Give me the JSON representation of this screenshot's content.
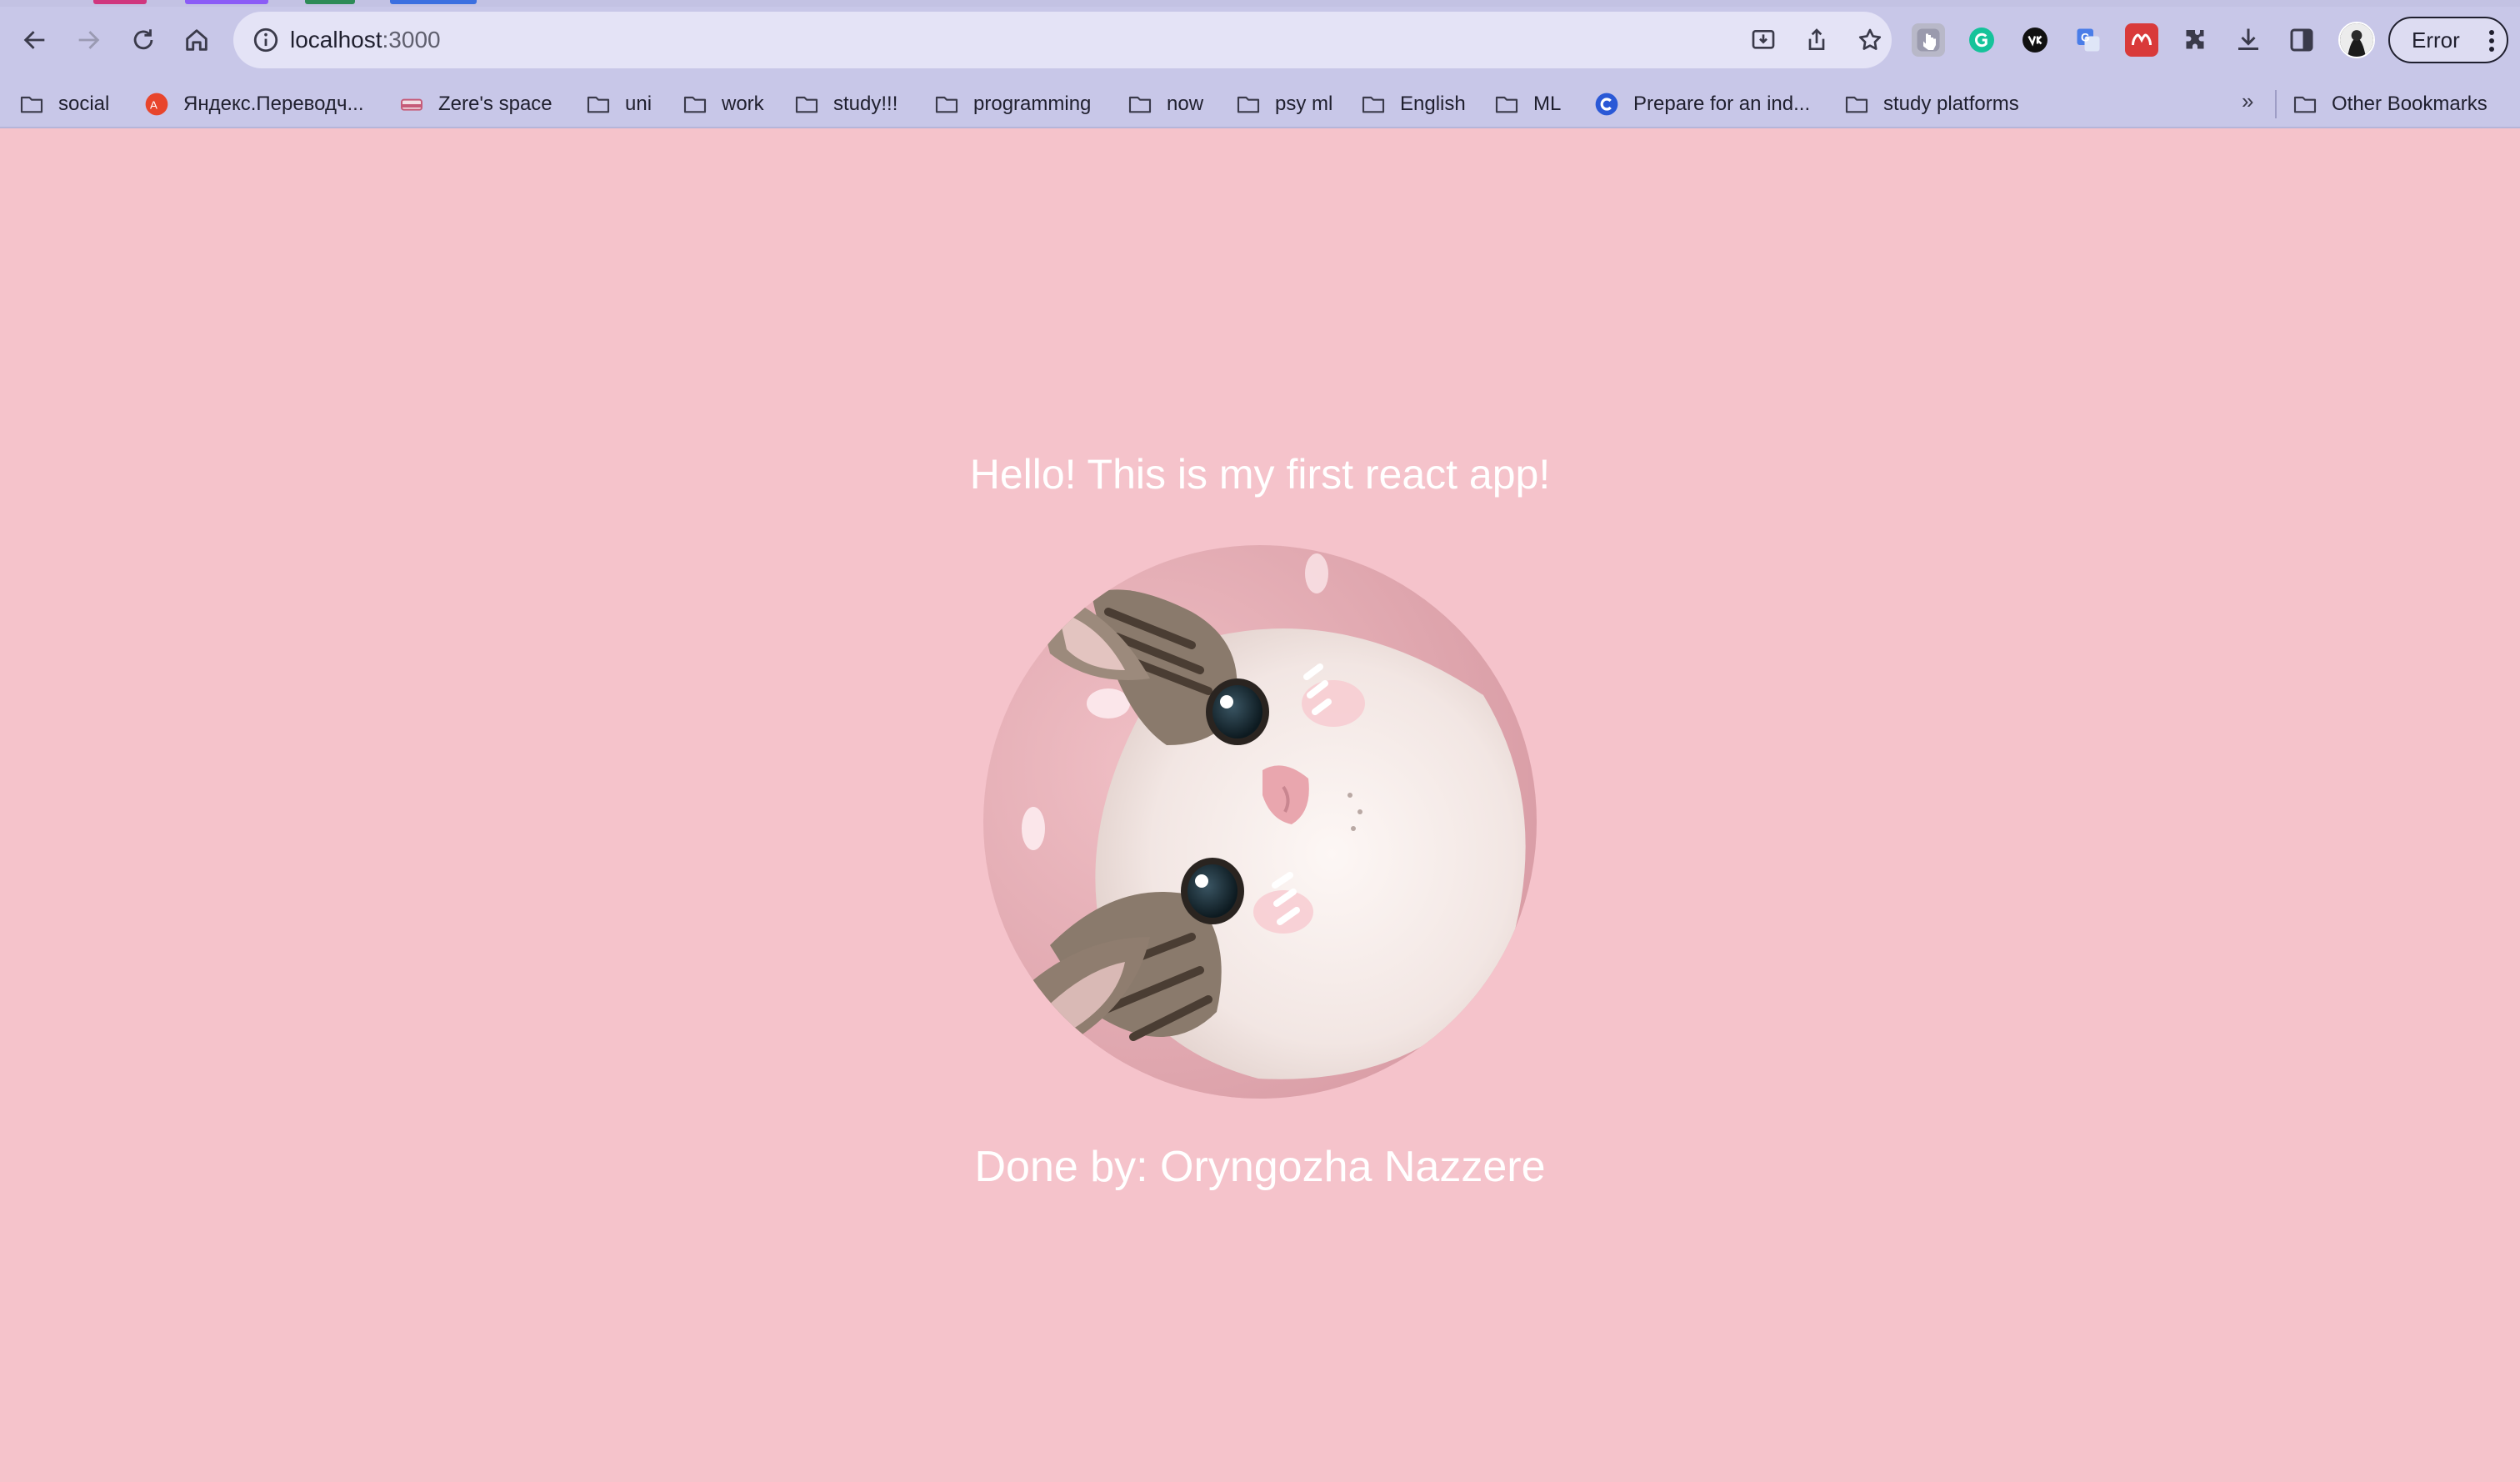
{
  "browser": {
    "url_host": "localhost",
    "url_port": ":3000",
    "error_label": "Error"
  },
  "bookmarks": [
    {
      "label": "social",
      "icon": "folder-icon"
    },
    {
      "label": "Яндекс.Переводч...",
      "icon": "yandex-translate-icon"
    },
    {
      "label": "Zere's space",
      "icon": "notion-space-icon"
    },
    {
      "label": "uni",
      "icon": "folder-icon"
    },
    {
      "label": "work",
      "icon": "folder-icon"
    },
    {
      "label": "study!!!",
      "icon": "folder-icon"
    },
    {
      "label": "programming",
      "icon": "folder-icon"
    },
    {
      "label": "now",
      "icon": "folder-icon"
    },
    {
      "label": "psy ml",
      "icon": "folder-icon"
    },
    {
      "label": "English",
      "icon": "folder-icon"
    },
    {
      "label": "ML",
      "icon": "folder-icon"
    },
    {
      "label": "Prepare for an ind...",
      "icon": "coursera-icon"
    },
    {
      "label": "study platforms",
      "icon": "folder-icon"
    }
  ],
  "more_bookmarks": "»",
  "other_bookmarks": "Other Bookmarks",
  "page": {
    "greeting": "Hello! This is my first react app!",
    "image_alt": "cat-photo",
    "credit": "Done by: Oryngozha Nazzere"
  },
  "colors": {
    "page_background": "#f5c3cb",
    "chrome_background": "#c8c7e8",
    "omnibox_background": "#e4e3f6",
    "text_on_page": "#ffffff"
  }
}
